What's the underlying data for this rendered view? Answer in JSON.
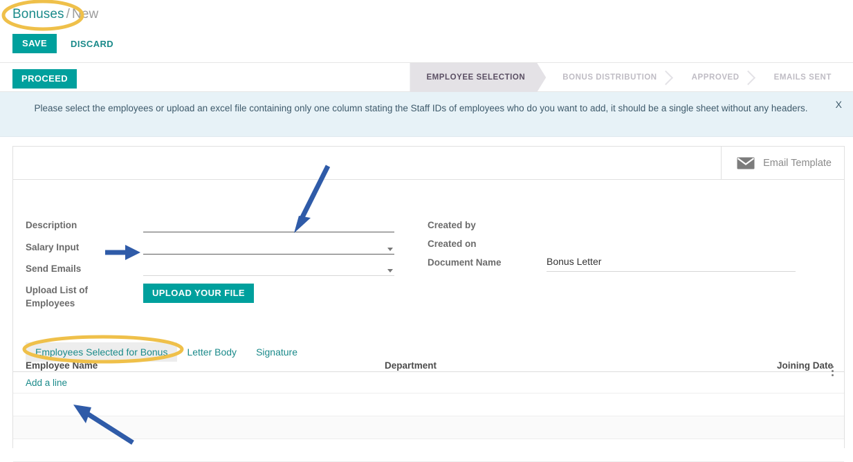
{
  "breadcrumb": {
    "root": "Bonuses",
    "separator": "/",
    "current": "New"
  },
  "toolbar": {
    "save_label": "SAVE",
    "discard_label": "DISCARD",
    "proceed_label": "PROCEED"
  },
  "statusbar": {
    "stages": [
      {
        "label": "EMPLOYEE SELECTION",
        "active": true
      },
      {
        "label": "BONUS DISTRIBUTION",
        "active": false
      },
      {
        "label": "APPROVED",
        "active": false
      },
      {
        "label": "EMAILS SENT",
        "active": false
      }
    ]
  },
  "alert": {
    "message": "Please select the employees or upload an excel file containing only one column stating the Staff IDs of employees who do you want to add, it should be a single sheet without any headers.",
    "close_label": "X"
  },
  "card": {
    "email_template_label": "Email Template"
  },
  "form": {
    "left": {
      "description_label": "Description",
      "description_value": "",
      "salary_input_label": "Salary Input",
      "salary_input_value": "",
      "send_emails_label": "Send Emails",
      "send_emails_value": "",
      "upload_label": "Upload List of Employees",
      "upload_button_label": "UPLOAD YOUR FILE"
    },
    "right": {
      "created_by_label": "Created by",
      "created_by_value": "",
      "created_on_label": "Created on",
      "created_on_value": "",
      "document_name_label": "Document Name",
      "document_name_value": "Bonus Letter"
    }
  },
  "tabs": [
    {
      "label": "Employees Selected for Bonus",
      "active": true
    },
    {
      "label": "Letter Body",
      "active": false
    },
    {
      "label": "Signature",
      "active": false
    }
  ],
  "table": {
    "columns": [
      "Employee Name",
      "Department",
      "Joining Date"
    ],
    "rows": [],
    "add_line_label": "Add a line",
    "options_icon": "kebab-menu-icon"
  },
  "colors": {
    "accent_teal": "#00a09d",
    "link_teal": "#1a8a8a",
    "alert_bg": "#e7f2f7",
    "annotation_yellow": "#efc04a",
    "annotation_blue": "#2f5ba8",
    "active_stage_bg": "#e4e2e6"
  },
  "icons": {
    "email": "envelope-icon",
    "dropdown": "chevron-down-icon"
  }
}
